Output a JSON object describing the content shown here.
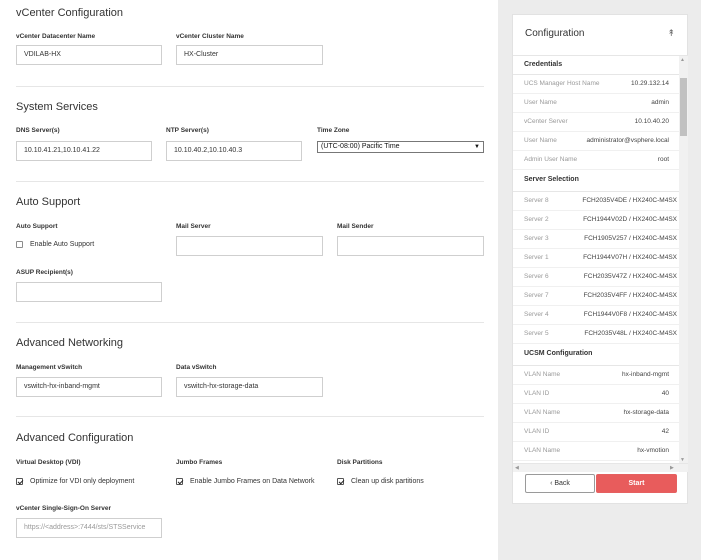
{
  "vcenter": {
    "title": "vCenter Configuration",
    "datacenter_label": "vCenter Datacenter Name",
    "datacenter_value": "VDILAB-HX",
    "cluster_label": "vCenter Cluster Name",
    "cluster_value": "HX-Cluster"
  },
  "system": {
    "title": "System Services",
    "dns_label": "DNS Server(s)",
    "dns_value": "10.10.41.21,10.10.41.22",
    "ntp_label": "NTP Server(s)",
    "ntp_value": "10.10.40.2,10.10.40.3",
    "tz_label": "Time Zone",
    "tz_value": "(UTC-08:00) Pacific Time"
  },
  "autosupport": {
    "title": "Auto Support",
    "as_label": "Auto Support",
    "enable_label": "Enable Auto Support",
    "enable_checked": false,
    "mail_server_label": "Mail Server",
    "mail_sender_label": "Mail Sender",
    "recipients_label": "ASUP Recipient(s)"
  },
  "networking": {
    "title": "Advanced Networking",
    "mgmt_label": "Management vSwitch",
    "mgmt_value": "vswitch-hx-inband-mgmt",
    "data_label": "Data vSwitch",
    "data_value": "vswitch-hx-storage-data"
  },
  "advanced": {
    "title": "Advanced Configuration",
    "vdi_label": "Virtual Desktop (VDI)",
    "vdi_option": "Optimize for VDI only deployment",
    "jumbo_label": "Jumbo Frames",
    "jumbo_option": "Enable Jumbo Frames on Data Network",
    "disk_label": "Disk Partitions",
    "disk_option": "Clean up disk partitions",
    "sso_label": "vCenter Single-Sign-On Server",
    "sso_placeholder": "https://<address>:7444/sts/STSService"
  },
  "panel": {
    "title": "Configuration",
    "credentials": {
      "title": "Credentials",
      "rows": [
        {
          "key": "UCS Manager Host Name",
          "value": "10.29.132.14"
        },
        {
          "key": "User Name",
          "value": "admin"
        },
        {
          "key": "vCenter Server",
          "value": "10.10.40.20"
        },
        {
          "key": "User Name",
          "value": "administrator@vsphere.local"
        },
        {
          "key": "Admin User Name",
          "value": "root"
        }
      ]
    },
    "servers": {
      "title": "Server Selection",
      "rows": [
        {
          "key": "Server 8",
          "value": "FCH2035V4DE / HX240C-M4SX"
        },
        {
          "key": "Server 2",
          "value": "FCH1944V02D / HX240C-M4SX"
        },
        {
          "key": "Server 3",
          "value": "FCH1905V257 / HX240C-M4SX"
        },
        {
          "key": "Server 1",
          "value": "FCH1944V07H / HX240C-M4SX"
        },
        {
          "key": "Server 6",
          "value": "FCH2035V47Z / HX240C-M4SX"
        },
        {
          "key": "Server 7",
          "value": "FCH2035V4FF / HX240C-M4SX"
        },
        {
          "key": "Server 4",
          "value": "FCH1944V0F8 / HX240C-M4SX"
        },
        {
          "key": "Server 5",
          "value": "FCH2035V48L / HX240C-M4SX"
        }
      ]
    },
    "ucsm": {
      "title": "UCSM Configuration",
      "rows": [
        {
          "key": "VLAN Name",
          "value": "hx-inband-mgmt"
        },
        {
          "key": "VLAN ID",
          "value": "40"
        },
        {
          "key": "VLAN Name",
          "value": "hx-storage-data"
        },
        {
          "key": "VLAN ID",
          "value": "42"
        },
        {
          "key": "VLAN Name",
          "value": "hx-vmotion"
        }
      ]
    },
    "back_label": "Back",
    "start_label": "Start"
  }
}
